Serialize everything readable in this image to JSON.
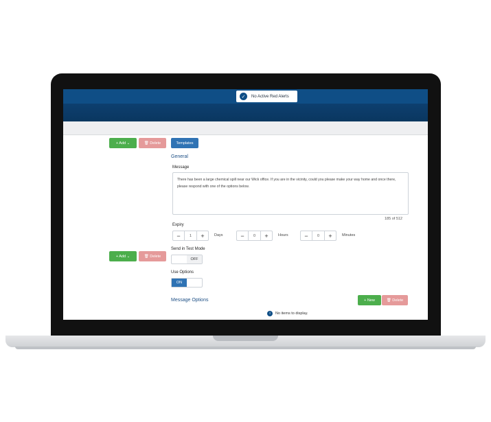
{
  "alert_banner": {
    "text": "No Active Red Alerts",
    "icon": "check-circle-icon"
  },
  "toolbar_top": {
    "add_label": "+ Add ⌄",
    "delete_label": "🗑 Delete",
    "templates_label": "Templates"
  },
  "toolbar_side": {
    "add_label": "+ Add ⌄",
    "delete_label": "🗑 Delete"
  },
  "general": {
    "title": "General",
    "message_label": "Message",
    "message_text": "There has been a large chemical spill near our Wick office. If you are in the vicinity, could you please make your way home and once there, please respond with one of the options below.",
    "char_counter": "185 of 512",
    "expiry_label": "Expiry",
    "expiry": [
      {
        "value": "1",
        "unit": "Days"
      },
      {
        "value": "0",
        "unit": "Hours"
      },
      {
        "value": "0",
        "unit": "Minutes"
      }
    ],
    "test_mode_label": "Send in Test Mode",
    "test_mode_state": "OFF",
    "use_options_label": "Use Options",
    "use_options_state": "ON"
  },
  "message_options": {
    "title": "Message Options",
    "new_label": "+ New",
    "delete_label": "🗑 Delete",
    "empty_text": "No items to display."
  },
  "colors": {
    "primary": "#0f4e86",
    "green": "#4cae4c",
    "red": "#e59a9a",
    "blue": "#2f73b4"
  }
}
